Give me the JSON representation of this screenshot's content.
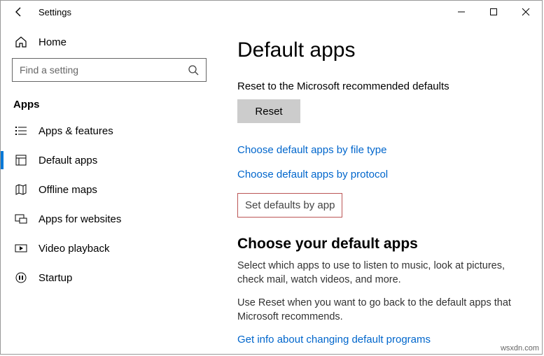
{
  "window": {
    "title": "Settings"
  },
  "sidebar": {
    "home": "Home",
    "search_placeholder": "Find a setting",
    "section": "Apps",
    "items": [
      {
        "label": "Apps & features"
      },
      {
        "label": "Default apps"
      },
      {
        "label": "Offline maps"
      },
      {
        "label": "Apps for websites"
      },
      {
        "label": "Video playback"
      },
      {
        "label": "Startup"
      }
    ]
  },
  "content": {
    "title": "Default apps",
    "reset_desc": "Reset to the Microsoft recommended defaults",
    "reset_btn": "Reset",
    "link_filetype": "Choose default apps by file type",
    "link_protocol": "Choose default apps by protocol",
    "set_defaults": "Set defaults by app",
    "sub_heading": "Choose your default apps",
    "para1": "Select which apps to use to listen to music, look at pictures, check mail, watch videos, and more.",
    "para2": "Use Reset when you want to go back to the default apps that Microsoft recommends.",
    "link_info": "Get info about changing default programs"
  },
  "watermark": "wsxdn.com"
}
